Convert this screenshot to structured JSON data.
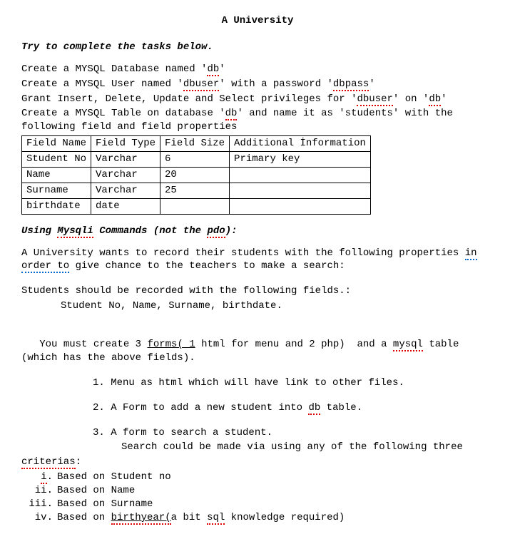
{
  "title": "A University",
  "intro": "Try to complete the tasks below.",
  "lines": {
    "l1a": "Create a MYSQL Database named '",
    "l1b": "db",
    "l1c": "'",
    "l2a": "Create a MYSQL User named '",
    "l2b": "dbuser",
    "l2c": "' with a password '",
    "l2d": "dbpass",
    "l2e": "'",
    "l3a": "Grant Insert, Delete, Update and Select privileges for '",
    "l3b": "dbuser",
    "l3c": "' on '",
    "l3d": "db",
    "l3e": "'",
    "l4a": "Create a MYSQL Table on database '",
    "l4b": "db",
    "l4c": "' and name it as 'students' with the following field and field properties"
  },
  "table": {
    "header": [
      "Field Name",
      "Field Type",
      "Field Size",
      "Additional İnformation"
    ],
    "rows": [
      [
        "Student No",
        "Varchar",
        "6",
        "Primary key"
      ],
      [
        "Name",
        "Varchar",
        "20",
        ""
      ],
      [
        "Surname",
        "Varchar",
        "25",
        ""
      ],
      [
        "birthdate",
        "date",
        "",
        ""
      ]
    ]
  },
  "section2": {
    "h_a": "Using ",
    "h_b": "Mysqli",
    "h_c": " Commands (not the ",
    "h_d": "pdo",
    "h_e": "):",
    "p1a": "A University wants to record their students with the following properties ",
    "p1b": "in order to",
    "p1c": " give chance to the teachers to make a search:",
    "p2": "Students should be recorded with the following fields.:",
    "p2fields": "Student No, Name, Surname, birthdate.",
    "p3a": "   You must create 3 ",
    "p3b": "forms( 1",
    "p3c": " html for menu and 2 php)  and a ",
    "p3d": "mysql",
    "p3e": " table (which has the above fields).",
    "li1": "1. Menu as html which will have link to other files.",
    "li2a": "2. A Form to add a new student into ",
    "li2b": "db",
    "li2c": " table.",
    "li3": "3. A form to search a student.",
    "li3sub": "Search could be made via using any of the following three ",
    "critword": "criterias",
    "colon": ":",
    "rom": [
      {
        "n": "i",
        "spelli": true,
        "t": "Based on Student no"
      },
      {
        "n": "ii.",
        "t": "Based on Name"
      },
      {
        "n": "iii.",
        "t": "Based on Surname"
      },
      {
        "n": "iv.",
        "t_a": "Based on ",
        "t_b": "birthyear(",
        "t_c": "a bit ",
        "t_d": "sql",
        "t_e": " knowledge required)"
      }
    ]
  }
}
